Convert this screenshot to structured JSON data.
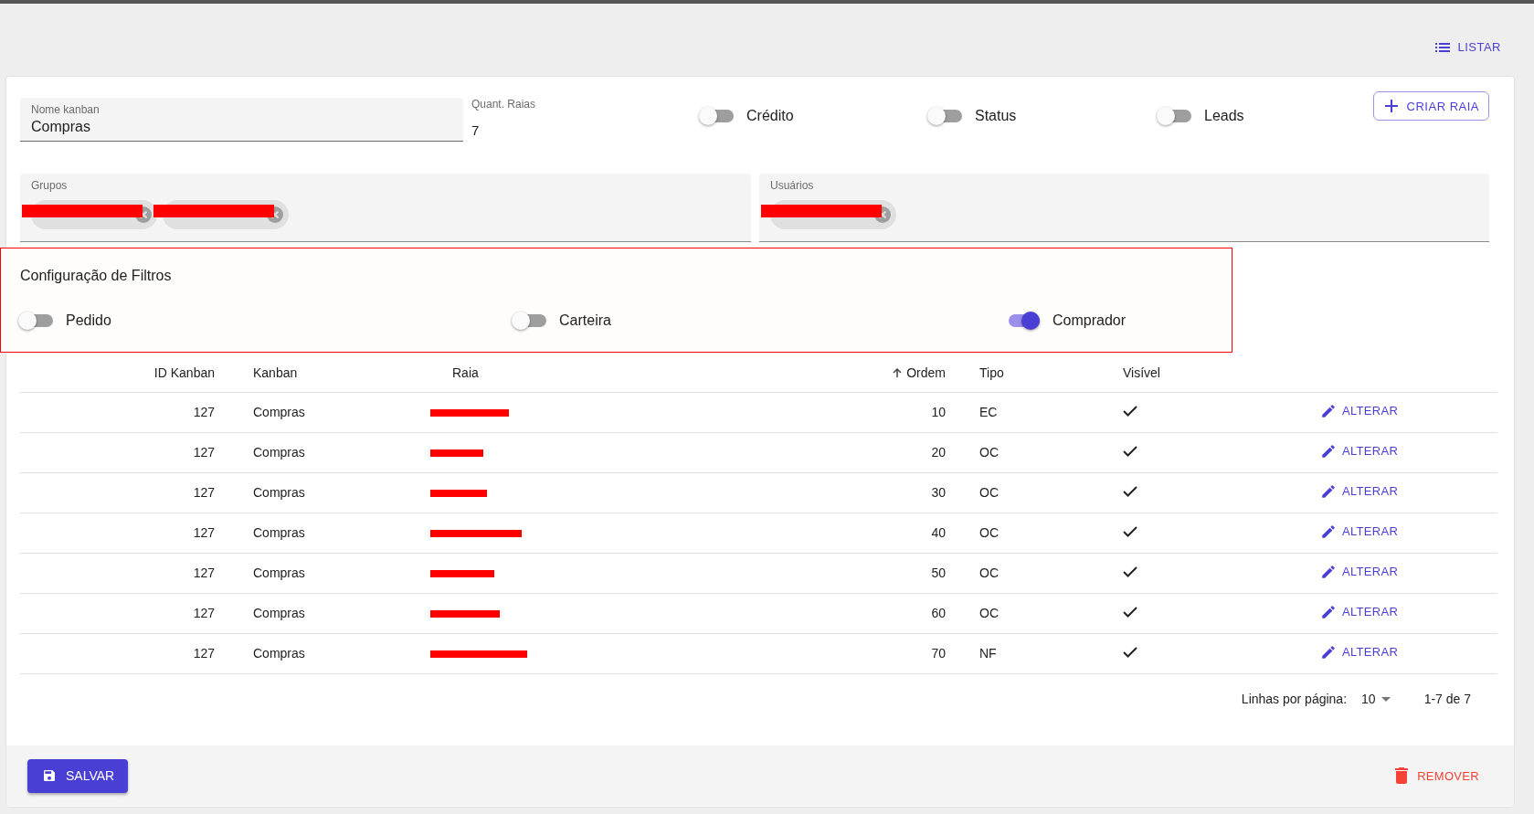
{
  "header": {
    "list_button": "LISTAR"
  },
  "form": {
    "name_field": {
      "label": "Nome kanban",
      "value": "Compras"
    },
    "lanes_count": {
      "label": "Quant. Raias",
      "value": "7"
    },
    "toggles": [
      {
        "label": "Crédito",
        "on": false
      },
      {
        "label": "Status",
        "on": false
      },
      {
        "label": "Leads",
        "on": false
      }
    ],
    "create_lane_button": "CRIAR RAIA",
    "groups_field": {
      "label": "Grupos",
      "chips": [
        {
          "redacted": true
        },
        {
          "redacted": true
        }
      ]
    },
    "users_field": {
      "label": "Usuários",
      "chips": [
        {
          "redacted": true
        }
      ]
    }
  },
  "filters": {
    "title": "Configuração de Filtros",
    "highlighted": true,
    "toggles": [
      {
        "label": "Pedido",
        "on": false
      },
      {
        "label": "Carteira",
        "on": false
      },
      {
        "label": "Comprador",
        "on": true
      }
    ]
  },
  "table": {
    "columns": [
      {
        "label": "ID Kanban",
        "sorted": false
      },
      {
        "label": "Kanban",
        "sorted": false
      },
      {
        "label": "Raia",
        "sorted": false
      },
      {
        "label": "Ordem",
        "sorted": true
      },
      {
        "label": "Tipo",
        "sorted": false
      },
      {
        "label": "Visível",
        "sorted": false
      }
    ],
    "rows": [
      {
        "id": "127",
        "kanban": "Compras",
        "raia_redacted": true,
        "ordem": "10",
        "tipo": "EC",
        "visible": true,
        "action": "ALTERAR"
      },
      {
        "id": "127",
        "kanban": "Compras",
        "raia_redacted": true,
        "ordem": "20",
        "tipo": "OC",
        "visible": true,
        "action": "ALTERAR"
      },
      {
        "id": "127",
        "kanban": "Compras",
        "raia_redacted": true,
        "ordem": "30",
        "tipo": "OC",
        "visible": true,
        "action": "ALTERAR"
      },
      {
        "id": "127",
        "kanban": "Compras",
        "raia_redacted": true,
        "ordem": "40",
        "tipo": "OC",
        "visible": true,
        "action": "ALTERAR"
      },
      {
        "id": "127",
        "kanban": "Compras",
        "raia_redacted": true,
        "ordem": "50",
        "tipo": "OC",
        "visible": true,
        "action": "ALTERAR"
      },
      {
        "id": "127",
        "kanban": "Compras",
        "raia_redacted": true,
        "ordem": "60",
        "tipo": "OC",
        "visible": true,
        "action": "ALTERAR"
      },
      {
        "id": "127",
        "kanban": "Compras",
        "raia_redacted": true,
        "ordem": "70",
        "tipo": "NF",
        "visible": true,
        "action": "ALTERAR"
      }
    ],
    "pagination": {
      "rows_label": "Linhas por página:",
      "rows_value": "10",
      "range": "1-7 de 7"
    }
  },
  "footer": {
    "save_button": "SALVAR",
    "remove_button": "REMOVER"
  }
}
